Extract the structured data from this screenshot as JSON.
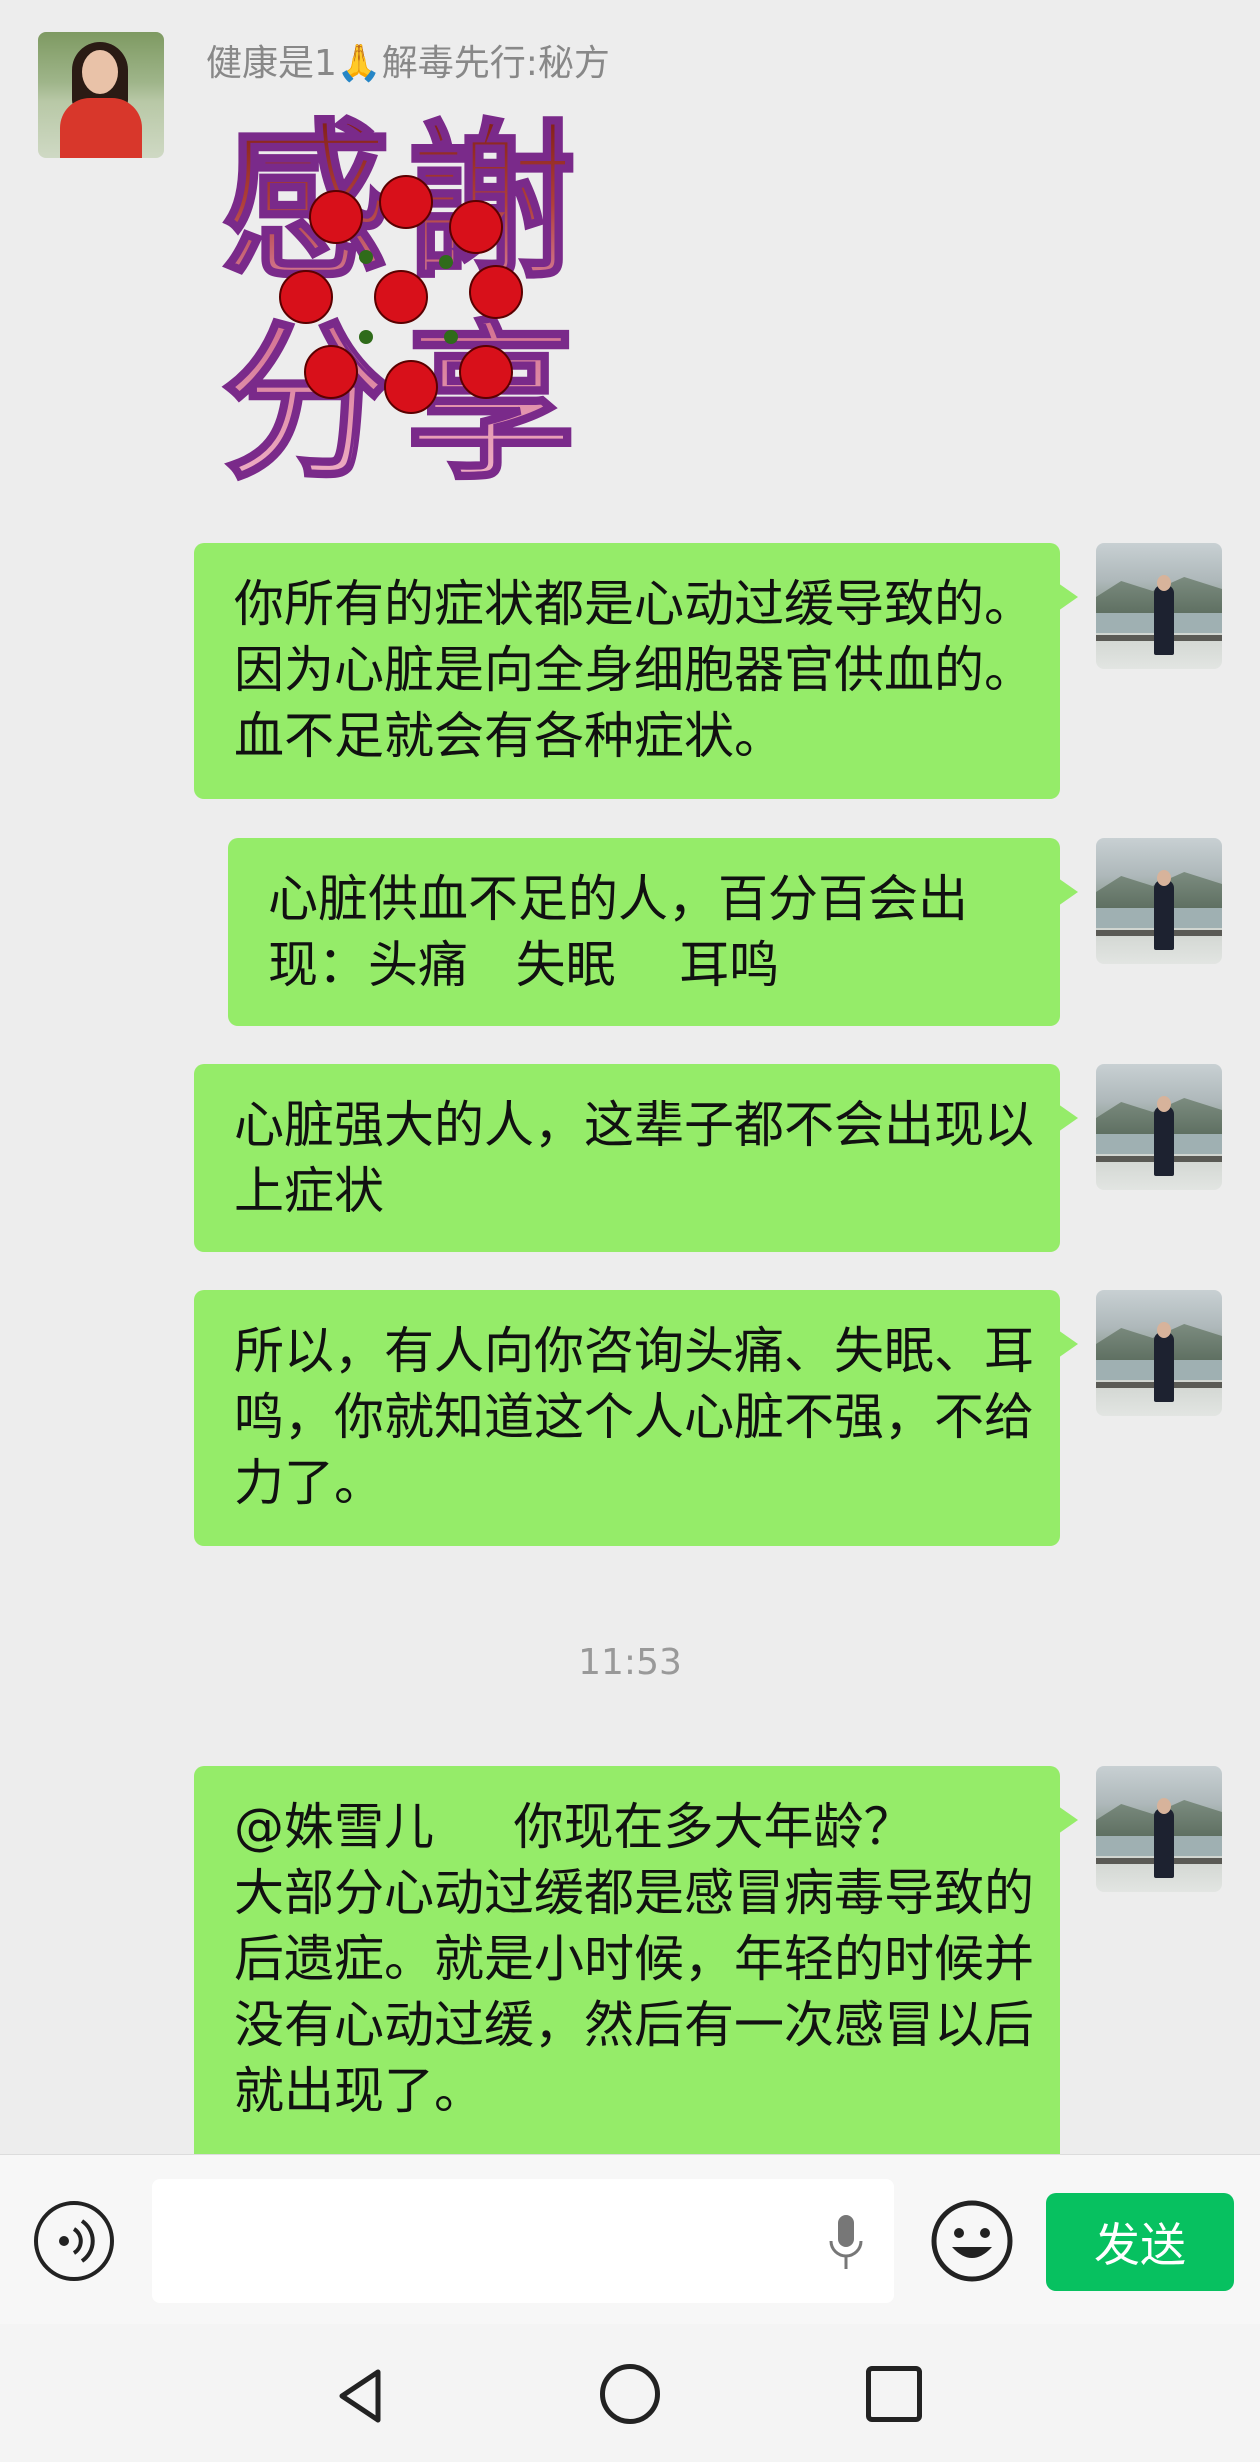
{
  "chat": {
    "sender_name": "健康是1🙏解毒先行:秘方",
    "sticker_text": [
      "感",
      "謝",
      "分",
      "享"
    ],
    "messages": [
      "你所有的症状都是心动过缓导致的。 因为心脏是向全身细胞器官供血的。 血不足就会有各种症状。",
      "心脏供血不足的人，百分百会出现：头痛   失眠    耳鸣",
      "心脏强大的人，这辈子都不会出现以上症状",
      "所以，有人向你咨询头痛、失眠、耳鸣，你就知道这个人心脏不强，不给力了。",
      "@姝雪儿     你现在多大年龄？        大部分心动过缓都是感冒病毒导致的后遗症。就是小时候，年轻的时候并没有心动过缓，然后有一次感冒以后就出现了。"
    ],
    "timestamp": "11:53"
  },
  "input_bar": {
    "send_label": "发送",
    "icons": [
      "voice-icon",
      "microphone-icon",
      "emoji-icon"
    ]
  },
  "nav_bar": {
    "icons": [
      "back-icon",
      "home-icon",
      "recent-apps-icon"
    ]
  },
  "colors": {
    "background": "#ededed",
    "bubble": "#95ec69",
    "send_button": "#07c160"
  }
}
